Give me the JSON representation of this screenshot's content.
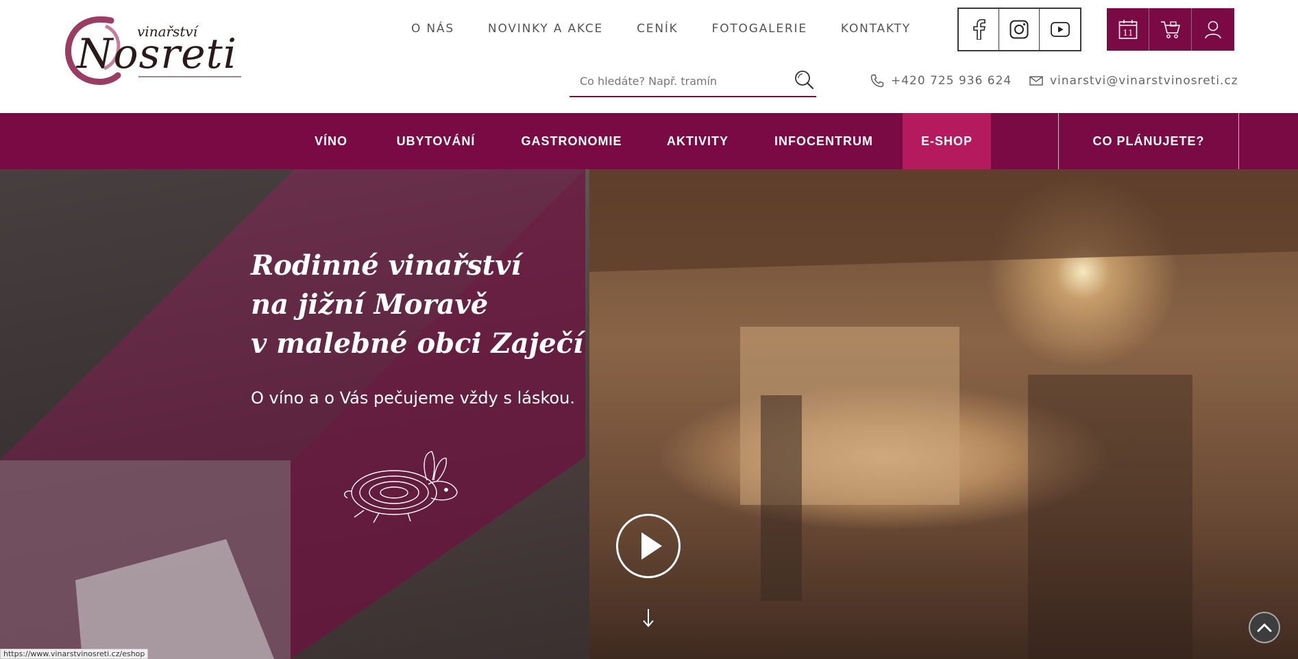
{
  "brand": {
    "small": "vinařství",
    "name": "Nosreti",
    "accent": "#7a0a44",
    "highlight": "#b5195e"
  },
  "topnav": [
    "O NÁS",
    "NOVINKY A AKCE",
    "CENÍK",
    "FOTOGALERIE",
    "KONTAKTY"
  ],
  "social": [
    "facebook-icon",
    "instagram-icon",
    "youtube-icon"
  ],
  "tools": [
    "calendar-icon",
    "cart-icon",
    "user-icon"
  ],
  "calendar_day": "11",
  "search": {
    "placeholder": "Co hledáte? Např. tramín"
  },
  "contact": {
    "phone": "+420 725 936 624",
    "email": "vinarstvi@vinarstvinosreti.cz"
  },
  "mainmenu": [
    "VÍNO",
    "UBYTOVÁNÍ",
    "GASTRONOMIE",
    "AKTIVITY",
    "INFOCENTRUM",
    "E-SHOP",
    "CO PLÁNUJETE?"
  ],
  "hero": {
    "title_lines": [
      "Rodinné vinařství",
      "na jižní Moravě",
      "v malebné obci Zaječí"
    ],
    "subtitle": "O víno a o Vás pečujeme vždy s láskou."
  },
  "statusbar": "https://www.vinarstvinosreti.cz/eshop"
}
